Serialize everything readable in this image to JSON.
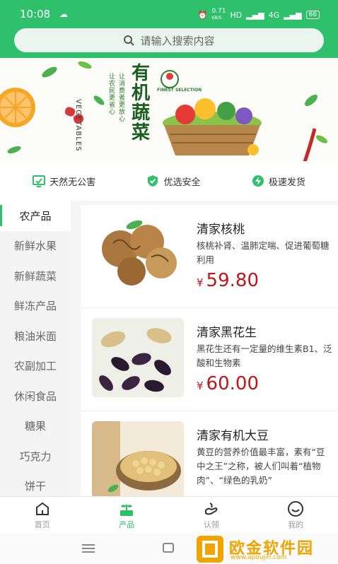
{
  "status_bar": {
    "time": "10:08",
    "speed": "0.71",
    "speed_unit": "KB/S",
    "hd": "HD",
    "signal": "4G",
    "battery": "66"
  },
  "search": {
    "placeholder": "请输入搜索内容"
  },
  "banner": {
    "title_cn": "有机蔬菜",
    "title_en": "VEGETABLES",
    "slogan_1": "让农民更省心",
    "slogan_2": "让消费者更放心",
    "badge": "FINEST SELECTION"
  },
  "features": [
    {
      "label": "天然无公害",
      "icon": "screen-icon"
    },
    {
      "label": "优选安全",
      "icon": "shield-icon"
    },
    {
      "label": "极速发货",
      "icon": "lightning-icon"
    }
  ],
  "categories": [
    "农产品",
    "新鲜水果",
    "新鲜蔬菜",
    "鲜冻产品",
    "粮油米面",
    "农副加工",
    "休闲食品",
    "糖果",
    "巧克力",
    "饼干"
  ],
  "active_category": "农产品",
  "products": [
    {
      "name": "清家核桃",
      "desc": "核桃补肾、温肺定喘、促进葡萄糖利用",
      "currency": "¥",
      "price": "59.80"
    },
    {
      "name": "清家黑花生",
      "desc": "黑花生还有一定量的维生素B1、泛酸和生物素",
      "currency": "¥",
      "price": "60.00"
    },
    {
      "name": "清家有机大豆",
      "desc": "黄豆的营养价值最丰富，素有“豆中之王”之称，被人们叫着“植物肉”、“绿色的乳奶”",
      "currency": "¥",
      "price": ""
    }
  ],
  "nav": [
    {
      "label": "首页",
      "icon": "home-icon",
      "active": false
    },
    {
      "label": "产品",
      "icon": "sprout-icon",
      "active": true
    },
    {
      "label": "认领",
      "icon": "hand-icon",
      "active": false
    },
    {
      "label": "我的",
      "icon": "smile-icon",
      "active": false
    }
  ],
  "watermark": {
    "text": "欧金软件园",
    "url": "www.apoujin.com"
  },
  "colors": {
    "primary": "#2ec06a",
    "price": "#c0151b",
    "watermark": "#f0a400"
  }
}
